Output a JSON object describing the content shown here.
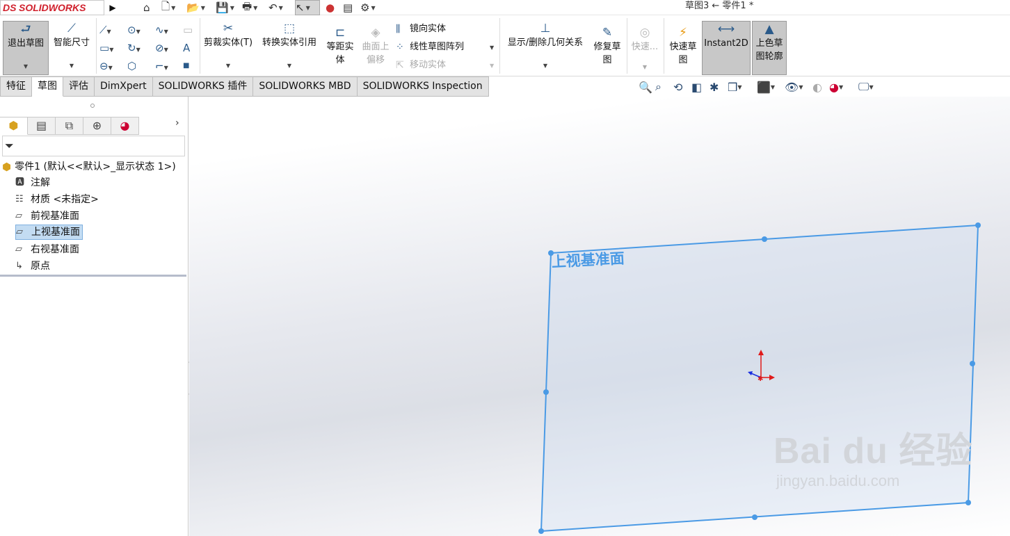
{
  "app": {
    "brand": "SOLIDWORKS",
    "brand_prefix": "DS",
    "doc_title": "草图3 ← 零件1 *"
  },
  "quick_access": [
    "home-icon",
    "new-icon",
    "open-icon",
    "save-icon",
    "print-icon",
    "undo-icon",
    "select-icon",
    "rebuild-icon",
    "options-icon",
    "settings-icon"
  ],
  "ribbon": {
    "exit_sketch": "退出草图",
    "smart_dim": "智能尺寸",
    "trim": "剪裁实体(T)",
    "convert": "转换实体引用",
    "offset_1": "等距实",
    "offset_2": "体",
    "surface_offset_1": "曲面上",
    "surface_offset_2": "偏移",
    "mirror": "镜向实体",
    "linear_pattern": "线性草图阵列",
    "move": "移动实体",
    "display_relations": "显示/删除几何关系",
    "repair_1": "修复草",
    "repair_2": "图",
    "quick_snap": "快速...",
    "rapid_sketch_1": "快速草",
    "rapid_sketch_2": "图",
    "instant2d": "Instant2D",
    "shaded_1": "上色草",
    "shaded_2": "图轮廓"
  },
  "tabs": [
    "特征",
    "草图",
    "评估",
    "DimXpert",
    "SOLIDWORKS 插件",
    "SOLIDWORKS MBD",
    "SOLIDWORKS Inspection"
  ],
  "active_tab": "草图",
  "feature_tree": {
    "root": "零件1  (默认<<默认>_显示状态 1>)",
    "items": [
      {
        "label": "注解",
        "icon": "annotation-icon"
      },
      {
        "label": "材质 <未指定>",
        "icon": "material-icon"
      },
      {
        "label": "前视基准面",
        "icon": "plane-icon"
      },
      {
        "label": "上视基准面",
        "icon": "plane-icon",
        "selected": true
      },
      {
        "label": "右视基准面",
        "icon": "plane-icon"
      },
      {
        "label": "原点",
        "icon": "origin-icon"
      }
    ]
  },
  "viewport": {
    "plane_label": "上视基准面",
    "plane_color": "#4a9ae5"
  },
  "watermark": {
    "main": "Bai du 经验",
    "sub": "jingyan.baidu.com"
  }
}
